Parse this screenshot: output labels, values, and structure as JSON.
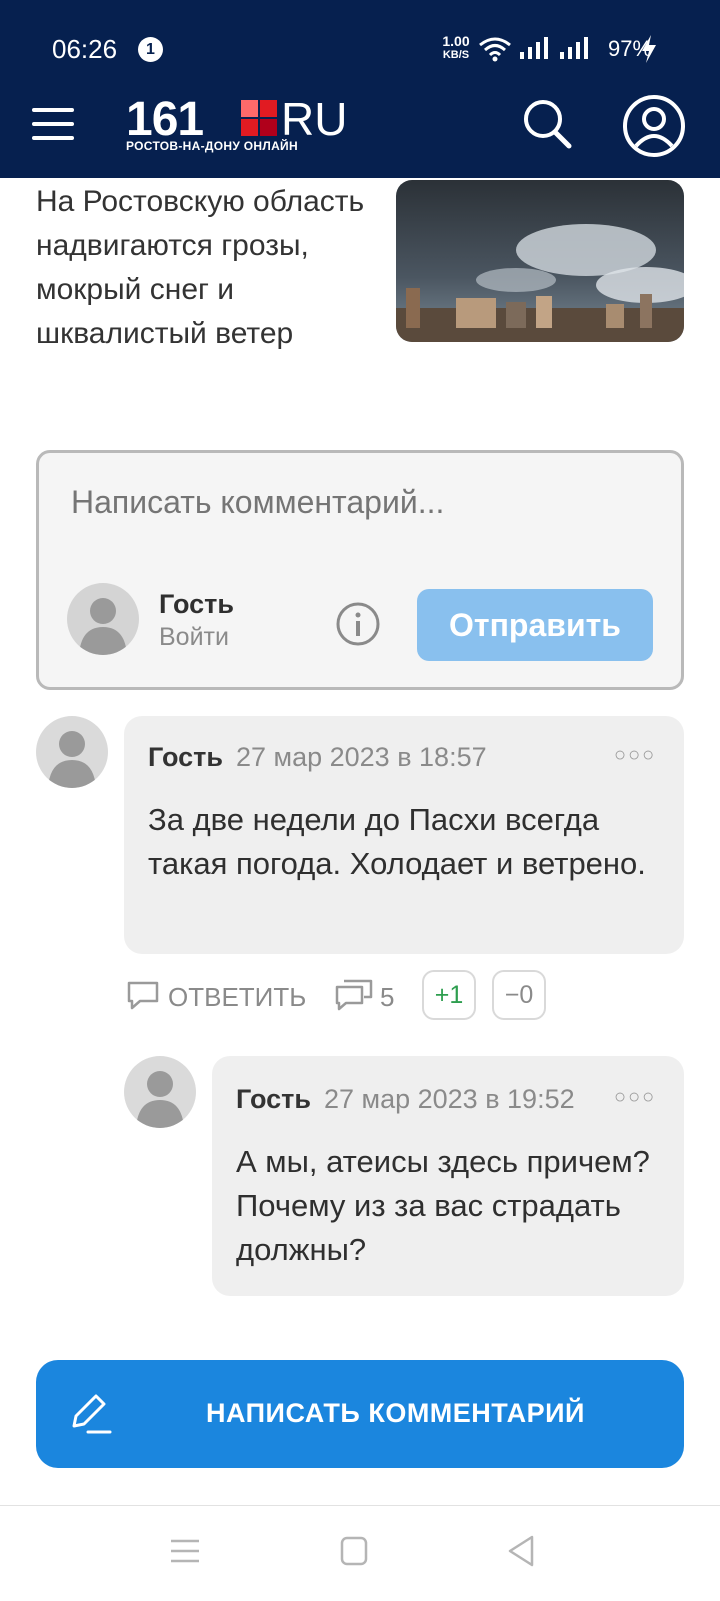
{
  "status_bar": {
    "time": "06:26",
    "notification_count": "1",
    "net_speed": "1.00",
    "net_speed_unit": "KB/S",
    "battery": "97%"
  },
  "header": {
    "logo_number": "161",
    "logo_suffix": "RU",
    "logo_subtitle": "РОСТОВ-НА-ДОНУ ОНЛАЙН",
    "icons": [
      "menu-icon",
      "search-icon",
      "profile-icon"
    ]
  },
  "teaser": {
    "title": "На Ростовскую область надвигаются грозы, мокрый снег и шквалистый ветер"
  },
  "comment_form": {
    "placeholder": "Написать комментарий...",
    "user_name": "Гость",
    "login_label": "Войти",
    "send_label": "Отправить"
  },
  "comments": [
    {
      "author": "Гость",
      "date": "27 мар 2023 в 18:57",
      "text": "За две недели до Пасхи всегда такая погода. Холодает и ветрено.",
      "reply_label": "ОТВЕТИТЬ",
      "replies_count": "5",
      "upvotes": "+1",
      "downvotes": "−0"
    },
    {
      "author": "Гость",
      "date": "27 мар 2023 в 19:52",
      "text": "А мы, атеисы здесь причем? Почему из за вас страдать должны?"
    }
  ],
  "write_comment_button": "НАПИСАТЬ КОММЕНТАРИЙ",
  "colors": {
    "header_bg": "#06204f",
    "send_button": "#89c0ee",
    "primary_button": "#1b86de",
    "upvote": "#2e9e4f"
  }
}
